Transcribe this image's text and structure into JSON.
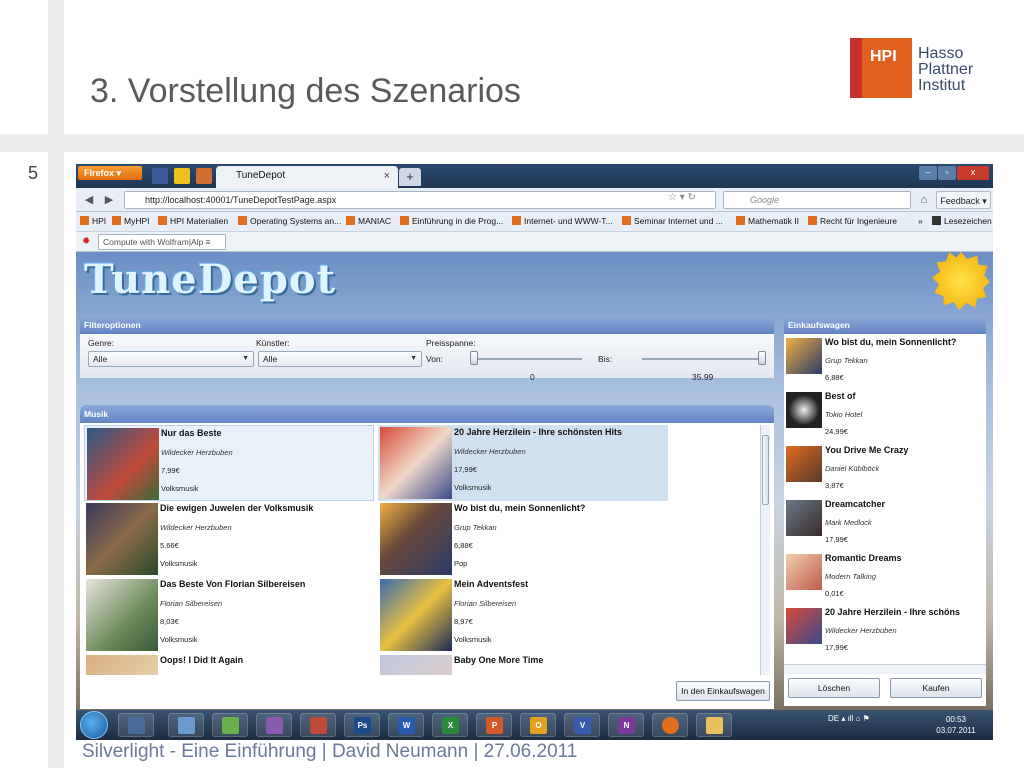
{
  "slide": {
    "title": "3. Vorstellung des Szenarios",
    "page_number": "5",
    "footer": "Silverlight - Eine Einführung | David Neumann | 27.06.2011",
    "logo": {
      "box_text": "HPI",
      "line1": "Hasso",
      "line2": "Plattner",
      "line3": "Institut"
    }
  },
  "browser": {
    "app_button": "Firefox",
    "tab_title": "TuneDepot",
    "tab_close": "×",
    "new_tab": "+",
    "url": "http://localhost:40001/TuneDepotTestPage.aspx",
    "search_placeholder": "Google",
    "feedback": "Feedback",
    "bookmarks": [
      "HPI",
      "MyHPI",
      "HPI Materialien",
      "Operating Systems an...",
      "MANIAC",
      "Einführung in die Prog...",
      "Internet- und WWW-T...",
      "Seminar Internet und ...",
      "Mathematik II",
      "Recht für Ingenieure",
      "Lesezeichen"
    ],
    "bookmarks_more": "»",
    "wolfram_placeholder": "Compute with Wolfram|Alp"
  },
  "app": {
    "logo_text": "TuneDepot",
    "filter": {
      "header": "Filteroptionen",
      "genre_label": "Genre:",
      "genre_value": "Alle",
      "artist_label": "Künstler:",
      "artist_value": "Alle",
      "price_label": "Preisspanne:",
      "from_label": "Von:",
      "to_label": "Bis:",
      "min_value": "0",
      "max_value": "35.99"
    },
    "music": {
      "header": "Musik",
      "items": [
        {
          "title": "Nur das Beste",
          "artist": "Wildecker Herzbuben",
          "price": "7,99€",
          "genre": "Volksmusik"
        },
        {
          "title": "20 Jahre Herzilein - Ihre schönsten Hits",
          "artist": "Wildecker Herzbuben",
          "price": "17,99€",
          "genre": "Volksmusik"
        },
        {
          "title": "Die ewigen Juwelen der Volksmusik",
          "artist": "Wildecker Herzbuben",
          "price": "5,66€",
          "genre": "Volksmusik"
        },
        {
          "title": "Wo bist du, mein Sonnenlicht?",
          "artist": "Grup Tekkan",
          "price": "6,88€",
          "genre": "Pop"
        },
        {
          "title": "Das Beste Von Florian Silbereisen",
          "artist": "Florian Silbereisen",
          "price": "8,03€",
          "genre": "Volksmusik"
        },
        {
          "title": "Mein Adventsfest",
          "artist": "Florian Silbereisen",
          "price": "8,97€",
          "genre": "Volksmusik"
        },
        {
          "title": "Oops! I Did It Again",
          "artist": "",
          "price": "",
          "genre": ""
        },
        {
          "title": "Baby One More Time",
          "artist": "",
          "price": "",
          "genre": ""
        }
      ],
      "add_button": "In den Einkaufswagen"
    },
    "cart": {
      "header": "Einkaufswagen",
      "items": [
        {
          "title": "Wo bist du, mein Sonnenlicht?",
          "artist": "Grup Tekkan",
          "price": "6,88€"
        },
        {
          "title": "Best of",
          "artist": "Tokio Hotel",
          "price": "24,99€"
        },
        {
          "title": "You Drive Me Crazy",
          "artist": "Daniel Küblböck",
          "price": "3,87€"
        },
        {
          "title": "Dreamcatcher",
          "artist": "Mark Medlock",
          "price": "17,99€"
        },
        {
          "title": "Romantic Dreams",
          "artist": "Modern Talking",
          "price": "0,01€"
        },
        {
          "title": "20 Jahre Herzilein - Ihre schöns",
          "artist": "Wildecker Herzbuben",
          "price": "17,99€"
        }
      ],
      "delete_button": "Löschen",
      "buy_button": "Kaufen"
    }
  },
  "taskbar": {
    "apps": [
      "",
      "",
      "",
      "",
      "",
      "Ps",
      "W",
      "X",
      "P",
      "O",
      "V",
      "N",
      "",
      ""
    ],
    "lang": "DE",
    "time": "00:53",
    "date": "03.07.2011"
  },
  "colors": {
    "accent": "#6384c4",
    "hpi_red": "#c8302a",
    "hpi_orange": "#e06020"
  }
}
